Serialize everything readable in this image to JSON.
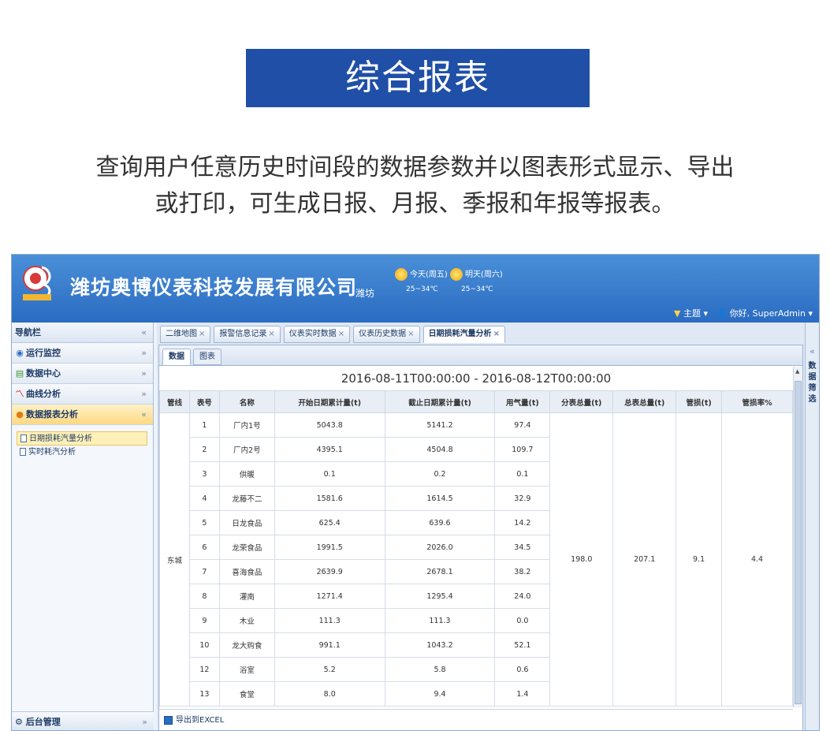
{
  "banner": {
    "title": "综合报表"
  },
  "description": {
    "line1": "查询用户任意历史时间段的数据参数并以图表形式显示、导出",
    "line2": "或打印，可生成日报、月报、季报和年报等报表。"
  },
  "header": {
    "company": "潍坊奥博仪表科技发展有限公司",
    "city": "潍坊",
    "weather_today": "今天(周五)",
    "weather_today_temp": "25~34℃",
    "weather_tomorrow": "明天(周六)",
    "weather_tomorrow_temp": "25~34℃",
    "theme": "主题",
    "user": "你好, SuperAdmin"
  },
  "sidebar": {
    "title": "导航栏",
    "items": [
      {
        "label": "运行监控",
        "icon": "monitor-icon"
      },
      {
        "label": "数据中心",
        "icon": "data-center-icon"
      },
      {
        "label": "曲线分析",
        "icon": "curve-icon"
      },
      {
        "label": "数据报表分析",
        "icon": "report-icon"
      }
    ],
    "subitems": [
      {
        "label": "日期损耗汽量分析"
      },
      {
        "label": "实时耗汽分析"
      }
    ],
    "footer": "后台管理"
  },
  "tabs": [
    {
      "label": "二维地图"
    },
    {
      "label": "报警信息记录"
    },
    {
      "label": "仪表实时数据"
    },
    {
      "label": "仪表历史数据"
    },
    {
      "label": "日期损耗汽量分析"
    }
  ],
  "subtabs": [
    {
      "label": "数据"
    },
    {
      "label": "图表"
    }
  ],
  "report": {
    "range": "2016-08-11T00:00:00 - 2016-08-12T00:00:00",
    "columns": [
      "管线",
      "表号",
      "名称",
      "开始日期累计量(t)",
      "截止日期累计量(t)",
      "用气量(t)",
      "分表总量(t)",
      "总表总量(t)",
      "管损(t)",
      "管损率%"
    ],
    "pipeline": "东城",
    "rows": [
      {
        "no": "1",
        "name": "厂内1号",
        "start": "5043.8",
        "end": "5141.2",
        "use": "97.4"
      },
      {
        "no": "2",
        "name": "厂内2号",
        "start": "4395.1",
        "end": "4504.8",
        "use": "109.7"
      },
      {
        "no": "3",
        "name": "供暖",
        "start": "0.1",
        "end": "0.2",
        "use": "0.1"
      },
      {
        "no": "4",
        "name": "龙藤不二",
        "start": "1581.6",
        "end": "1614.5",
        "use": "32.9"
      },
      {
        "no": "5",
        "name": "日龙食品",
        "start": "625.4",
        "end": "639.6",
        "use": "14.2"
      },
      {
        "no": "6",
        "name": "龙荣食品",
        "start": "1991.5",
        "end": "2026.0",
        "use": "34.5"
      },
      {
        "no": "7",
        "name": "喜海食品",
        "start": "2639.9",
        "end": "2678.1",
        "use": "38.2"
      },
      {
        "no": "8",
        "name": "灌南",
        "start": "1271.4",
        "end": "1295.4",
        "use": "24.0"
      },
      {
        "no": "9",
        "name": "木业",
        "start": "111.3",
        "end": "111.3",
        "use": "0.0"
      },
      {
        "no": "10",
        "name": "龙大购食",
        "start": "991.1",
        "end": "1043.2",
        "use": "52.1"
      },
      {
        "no": "12",
        "name": "浴室",
        "start": "5.2",
        "end": "5.8",
        "use": "0.6"
      },
      {
        "no": "13",
        "name": "食堂",
        "start": "8.0",
        "end": "9.4",
        "use": "1.4"
      }
    ],
    "sub_total": "198.0",
    "main_total": "207.1",
    "loss": "9.1",
    "loss_rate": "4.4"
  },
  "export": {
    "label": "导出到EXCEL"
  },
  "right_panel": {
    "label": "数据筛选"
  },
  "colors": {
    "banner": "#1f4fa6",
    "header": "#2a6cc2",
    "active": "#ffd983"
  }
}
